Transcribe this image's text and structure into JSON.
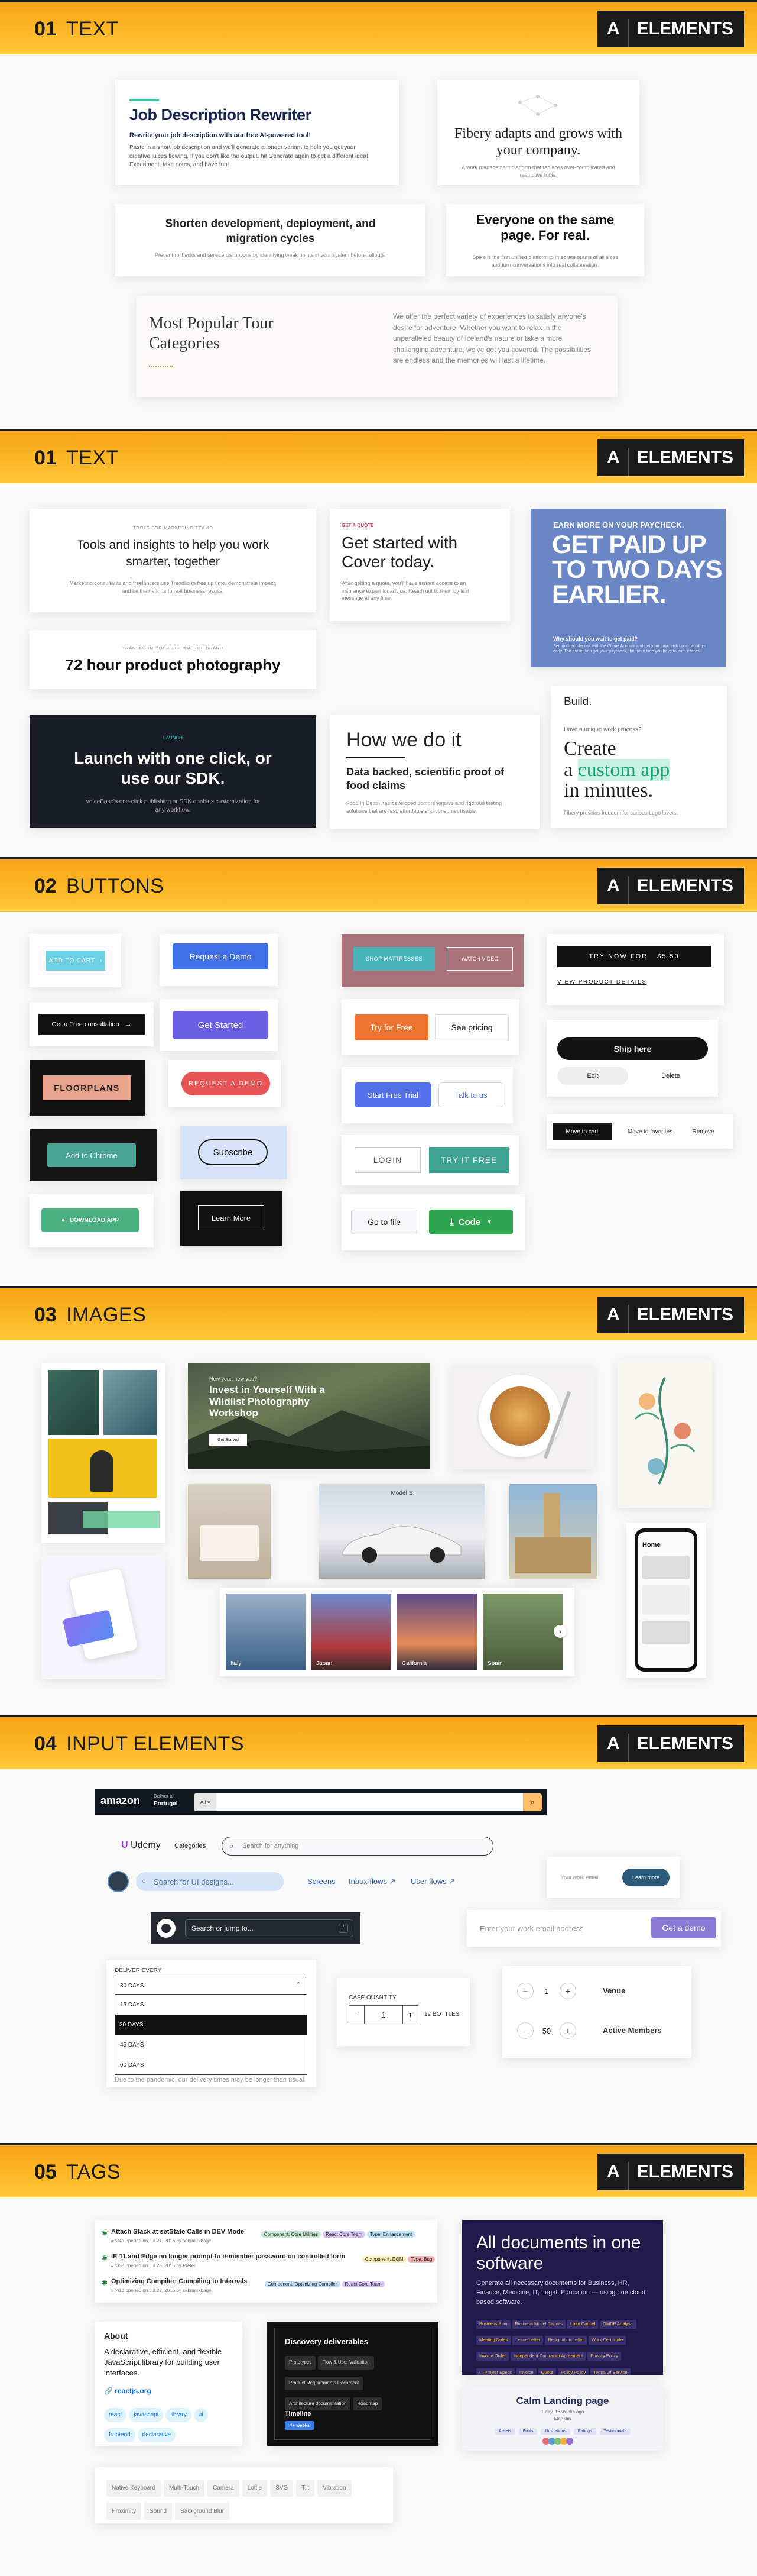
{
  "brand": {
    "a": "A",
    "elements": "ELEMENTS"
  },
  "sections": [
    {
      "num": "01",
      "title": "TEXT"
    },
    {
      "num": "01",
      "title": "TEXT"
    },
    {
      "num": "02",
      "title": "BUTTONS"
    },
    {
      "num": "03",
      "title": "IMAGES"
    },
    {
      "num": "04",
      "title": "INPUT ELEMENTS"
    },
    {
      "num": "05",
      "title": "TAGS"
    }
  ],
  "text1": {
    "jd_title": "Job Description Rewriter",
    "jd_sub": "Rewrite your job description with our free AI-powered tool!",
    "jd_body": "Paste in a short job description and we'll generate a longer variant to help you get your creative juices flowing. If you don't like the output, hit Generate again to get a different idea! Experiment, take notes, and have fun!",
    "fibery_title": "Fibery adapts and grows with your company.",
    "fibery_body": "A work management platform that replaces over-complicated and restrictive tools.",
    "shorten_title": "Shorten development, deployment, and migration cycles",
    "shorten_body": "Prevent rollbacks and service disruptions by identifying weak points in your system before rollouts.",
    "same_page_title": "Everyone on the same page. For real.",
    "same_page_body": "Spike is the first unified platform to integrate teams of all sizes and turn conversations into real collaboration.",
    "tour_title": "Most Popular Tour Categories",
    "tour_body": "We offer the perfect variety of experiences to satisfy anyone's desire for adventure. Whether you want to relax in the unparalleled beauty of Iceland's nature or take a more challenging adventure, we've got you covered. The possibilities are endless and the memories will last a lifetime."
  },
  "text2": {
    "tools_kicker": "TOOLS FOR MARKETING TEAMS",
    "tools_title": "Tools and insights to help you work smarter, together",
    "tools_body": "Marketing consultants and freelancers use Trendlio to free up time, demonstrate impact, and be their efforts to real business results.",
    "cover_kicker": "GET A QUOTE",
    "cover_title": "Get started with Cover today.",
    "cover_body": "After getting a quote, you'll have instant access to an insurance expert for advice. Reach out to them by text message at any time.",
    "paid_kicker": "EARN MORE ON YOUR PAYCHECK.",
    "paid_title": "GET PAID UP TO TWO DAYS EARLIER.",
    "paid_q": "Why should you wait to get paid?",
    "paid_body": "Set up direct deposit with the Chime Account and get your paycheck up to two days early. The earlier you get your paycheck, the more time you have to earn interest.",
    "photo_kicker": "TRANSFORM YOUR ECOMMERCE BRAND",
    "photo_title": "72 hour product photography",
    "build_word": "Build.",
    "build_q": "Have a unique work process?",
    "build_line1": "Create",
    "build_line2a": "a ",
    "build_line2b": "custom app",
    "build_line3": "in minutes.",
    "build_body": "Fibery provides freedom for curious Lego lovers.",
    "launch_kicker": "LAUNCH",
    "launch_title": "Launch with one click, or use our SDK.",
    "launch_body": "VoiceBase's one-click publishing or SDK enables customization for any workflow.",
    "how_title": "How we do it",
    "how_sub": "Data backed, scientific proof of food claims",
    "how_body": "Food In Depth has developed comprehensive and rigorous testing solutions that are fast, affordable and consumer usable."
  },
  "buttons": {
    "add_to_cart": "ADD TO CART",
    "request_demo": "Request a Demo",
    "shop_mattresses": "SHOP MATTRESSES",
    "watch_video": "WATCH VIDEO",
    "try_now": "TRY NOW FOR",
    "try_price": "$5.50",
    "view_details": "VIEW PRODUCT DETAILS",
    "free_consult": "Get a Free consultation",
    "get_started": "Get Started",
    "try_free": "Try for Free",
    "see_pricing": "See pricing",
    "ship_here": "Ship here",
    "edit": "Edit",
    "delete": "Delete",
    "floorplans": "FLOORPLANS",
    "request_a_demo": "REQUEST A DEMO",
    "start_trial": "Start Free Trial",
    "talk_to_us": "Talk to us",
    "move_to_cart": "Move to cart",
    "move_to_favorites": "Move to favorites",
    "remove": "Remove",
    "add_to_chrome": "Add to Chrome",
    "subscribe": "Subscribe",
    "login": "LOGIN",
    "try_it_free": "TRY IT FREE",
    "download_app": "DOWNLOAD APP",
    "learn_more": "Learn More",
    "go_to_file": "Go to file",
    "code": "Code"
  },
  "images": {
    "workshop_kicker": "New year, new you?",
    "workshop_title": "Invest in Yourself With a Wildlist Photography Workshop",
    "workshop_btn": "Get Started",
    "car_title": "Model S",
    "cities": [
      "Italy",
      "Japan",
      "California",
      "Spain"
    ],
    "phone_title": "Home"
  },
  "inputs": {
    "amazon_logo": "amazon",
    "amazon_deliver": "Deliver to",
    "amazon_country": "Portugal",
    "amazon_cat": "All",
    "udemy_logo": "Udemy",
    "udemy_categories": "Categories",
    "udemy_placeholder": "Search for anything",
    "work_email_placeholder": "Your work email",
    "learn_more": "Learn more",
    "dribbble_placeholder": "Search for UI designs...",
    "screens": "Screens",
    "inbox_flows": "Inbox flows",
    "user_flows": "User flows",
    "github_placeholder": "Search or jump to...",
    "slash_key": "/",
    "enter_email_placeholder": "Enter your work email address",
    "get_demo": "Get a demo",
    "deliver_every": "DELIVER EVERY",
    "deliver_options": [
      "30 DAYS",
      "15 DAYS",
      "30 DAYS",
      "45 DAYS",
      "60 DAYS"
    ],
    "deliver_note": "Due to the pandemic, our delivery times may be longer than usual.",
    "case_qty_label": "CASE QUANTITY",
    "case_qty": "1",
    "case_bottles": "12 BOTTLES",
    "venue_count": "1",
    "venue_label": "Venue",
    "members_count": "50",
    "members_label": "Active Members"
  },
  "tags": {
    "issues": [
      {
        "title": "Attach Stack at setState Calls in DEV Mode",
        "meta": "#7341 opened on Jul 21, 2016 by sebmarkbage",
        "tags": [
          [
            "Component: Core Utilities",
            "#c7e9d4"
          ],
          [
            "React Core Team",
            "#d9c7f5"
          ],
          [
            "Type: Enhancement",
            "#b9e2f7"
          ]
        ]
      },
      {
        "title": "IE 11 and Edge no longer prompt to remember password on controlled form",
        "meta": "#7358 opened on Jul 25, 2016 by Prefer",
        "tags": [
          [
            "Component: DOM",
            "#f7ecb4"
          ],
          [
            "Type: Bug",
            "#f4b4b4"
          ]
        ]
      },
      {
        "title": "Optimizing Compiler: Compiling to Internals",
        "meta": "#7413 opened on Jul 27, 2016 by sebmarkbage",
        "tags": [
          [
            "Component: Optimizing Compiler",
            "#c7e0f4"
          ],
          [
            "React Core Team",
            "#d9c7f5"
          ]
        ]
      }
    ],
    "about_title": "About",
    "about_body": "A declarative, efficient, and flexible JavaScript library for building user interfaces.",
    "about_link": "reactjs.org",
    "about_topics": [
      "react",
      "javascript",
      "library",
      "ui",
      "frontend",
      "declarative"
    ],
    "discovery_title": "Discovery deliverables",
    "discovery_tags": [
      "Prototypes",
      "Flow & User Validation",
      "Product Requirements Document",
      "Architecture documentation",
      "Roadmap"
    ],
    "timeline_title": "Timeline",
    "timeline_tag": "4+ weeks",
    "docs_title": "All documents in one software",
    "docs_body": "Generate all necessary documents for Business, HR, Finance, Medicine, IT, Legal, Education — using one cloud based software.",
    "docs_tags": [
      "Business Plan",
      "Business Model Canvas",
      "Loan Cancel",
      "GMDP Analysis",
      "Meeting Notes",
      "Lease Letter",
      "Resignation Letter",
      "Work Certificate",
      "Invoice Order",
      "Independent Contractor Agreement",
      "Privacy Policy",
      "IT Project Specs",
      "Invoice",
      "Quote",
      "Policy Policy",
      "Terms Of Service",
      "Certificate Of Completion",
      "Medical Certificate",
      "Prescription"
    ],
    "calm_title": "Calm Landing page",
    "calm_sub": "1 day, 16 weeks ago",
    "calm_sub2": "Medium",
    "calm_tags": [
      "Assets",
      "Fonts",
      "Illustrations",
      "Ratings",
      "Testimonials"
    ],
    "plain_tags": [
      "Native Keyboard",
      "Multi-Touch",
      "Camera",
      "Lottie",
      "SVG",
      "Tilt",
      "Vibration",
      "Proximity",
      "Sound",
      "Background Blur"
    ]
  },
  "colors": {
    "band_top": "#f7a414",
    "band_bottom": "#ffc736",
    "dark": "#1a1a1a"
  }
}
